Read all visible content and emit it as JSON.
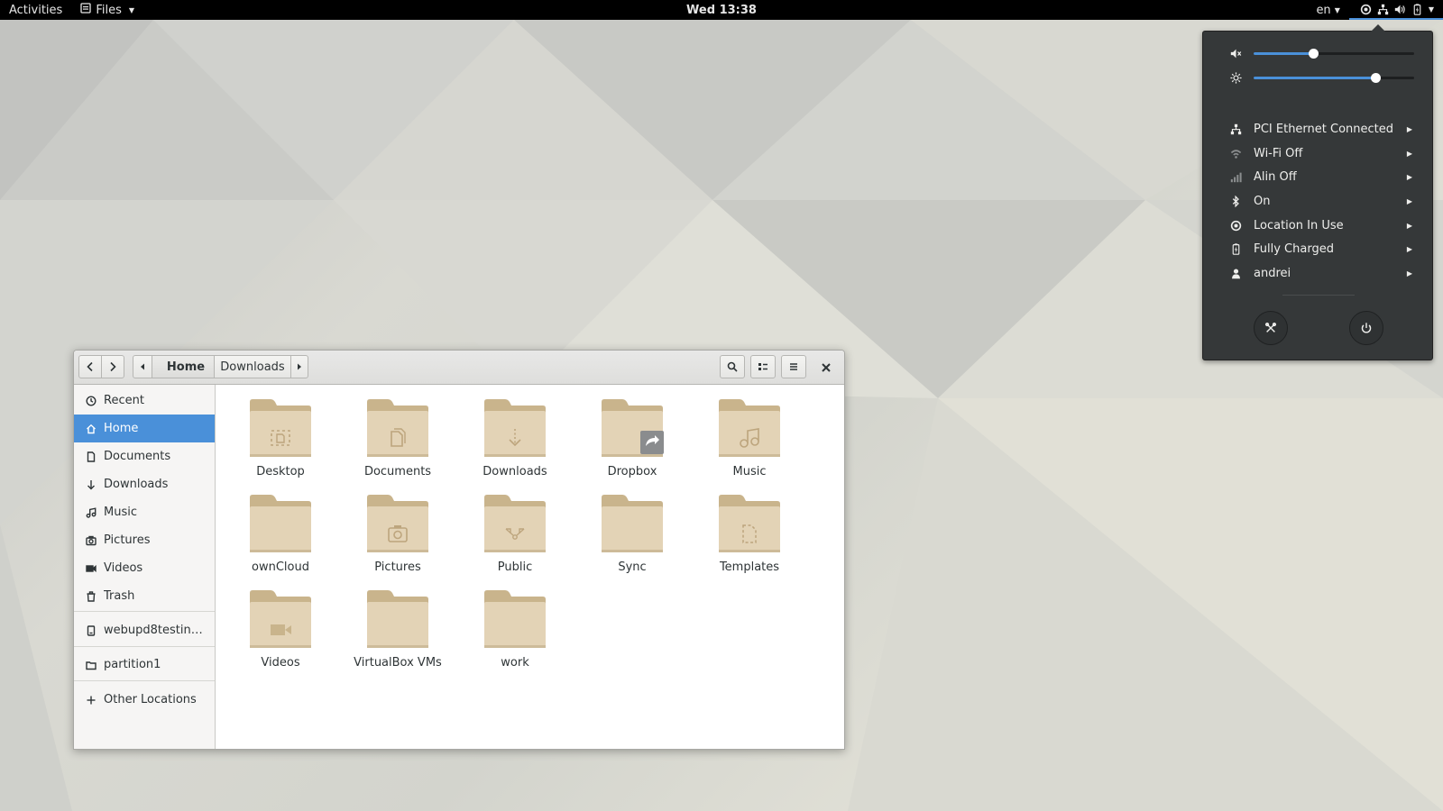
{
  "topbar": {
    "activities": "Activities",
    "app_menu": "Files",
    "clock": "Wed 13:38",
    "language": "en"
  },
  "system_menu": {
    "volume_level": 0.37,
    "brightness_level": 0.76,
    "items": [
      {
        "label": "PCI Ethernet Connected",
        "icon": "network-wired-icon"
      },
      {
        "label": "Wi-Fi Off",
        "icon": "wifi-icon"
      },
      {
        "label": "Alin Off",
        "icon": "cellular-signal-icon"
      },
      {
        "label": "On",
        "icon": "bluetooth-icon"
      },
      {
        "label": "Location In Use",
        "icon": "location-icon"
      },
      {
        "label": "Fully Charged",
        "icon": "battery-icon"
      },
      {
        "label": "andrei",
        "icon": "user-icon"
      }
    ]
  },
  "window": {
    "breadcrumb": {
      "home": "Home",
      "current": "Downloads"
    },
    "sidebar": [
      {
        "label": "Recent",
        "icon": "clock-icon"
      },
      {
        "label": "Home",
        "icon": "home-icon",
        "selected": true
      },
      {
        "label": "Documents",
        "icon": "document-icon"
      },
      {
        "label": "Downloads",
        "icon": "download-icon"
      },
      {
        "label": "Music",
        "icon": "music-icon"
      },
      {
        "label": "Pictures",
        "icon": "camera-icon"
      },
      {
        "label": "Videos",
        "icon": "video-icon"
      },
      {
        "label": "Trash",
        "icon": "trash-icon"
      },
      {
        "label": "webupd8testing...",
        "icon": "drive-icon"
      },
      {
        "label": "partition1",
        "icon": "folder-icon"
      },
      {
        "label": "Other Locations",
        "icon": "plus-icon"
      }
    ],
    "files": [
      {
        "name": "Desktop",
        "emblem": "desktop"
      },
      {
        "name": "Documents",
        "emblem": "documents"
      },
      {
        "name": "Downloads",
        "emblem": "downloads"
      },
      {
        "name": "Dropbox",
        "emblem": "link"
      },
      {
        "name": "Music",
        "emblem": "music"
      },
      {
        "name": "ownCloud",
        "emblem": "none"
      },
      {
        "name": "Pictures",
        "emblem": "pictures"
      },
      {
        "name": "Public",
        "emblem": "public"
      },
      {
        "name": "Sync",
        "emblem": "none"
      },
      {
        "name": "Templates",
        "emblem": "templates"
      },
      {
        "name": "Videos",
        "emblem": "videos"
      },
      {
        "name": "VirtualBox VMs",
        "emblem": "none"
      },
      {
        "name": "work",
        "emblem": "none"
      }
    ]
  },
  "colors": {
    "accent": "#4a90d9",
    "folder": "#e3d3b6",
    "folder_back": "#c9b48c",
    "menu_bg": "#353839"
  }
}
